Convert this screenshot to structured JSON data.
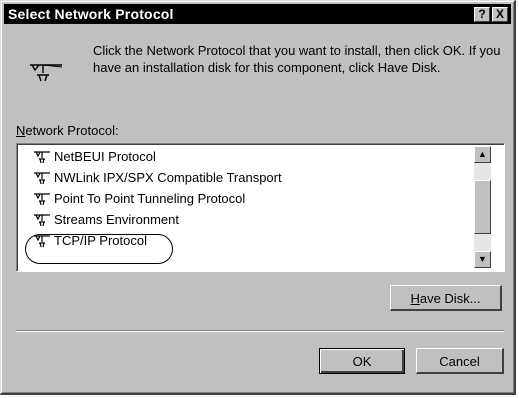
{
  "window": {
    "title": "Select Network Protocol",
    "help_glyph": "?",
    "close_glyph": "X"
  },
  "instructions": "Click the Network Protocol that you want to install, then click OK.  If you have an installation disk for this component, click Have Disk.",
  "list": {
    "label": "Network Protocol:",
    "items": [
      {
        "label": "NetBEUI Protocol",
        "icon": "network-protocol-icon"
      },
      {
        "label": "NWLink IPX/SPX Compatible Transport",
        "icon": "network-protocol-icon"
      },
      {
        "label": "Point To Point Tunneling Protocol",
        "icon": "network-protocol-icon"
      },
      {
        "label": "Streams Environment",
        "icon": "network-protocol-icon"
      },
      {
        "label": "TCP/IP Protocol",
        "icon": "network-protocol-icon"
      }
    ],
    "highlighted_item": "TCP/IP Protocol"
  },
  "buttons": {
    "have_disk": "Have Disk...",
    "ok": "OK",
    "cancel": "Cancel"
  },
  "colors": {
    "dialog_face": "#c0c0c0",
    "titlebar": "#000000",
    "list_background": "#ffffff"
  }
}
